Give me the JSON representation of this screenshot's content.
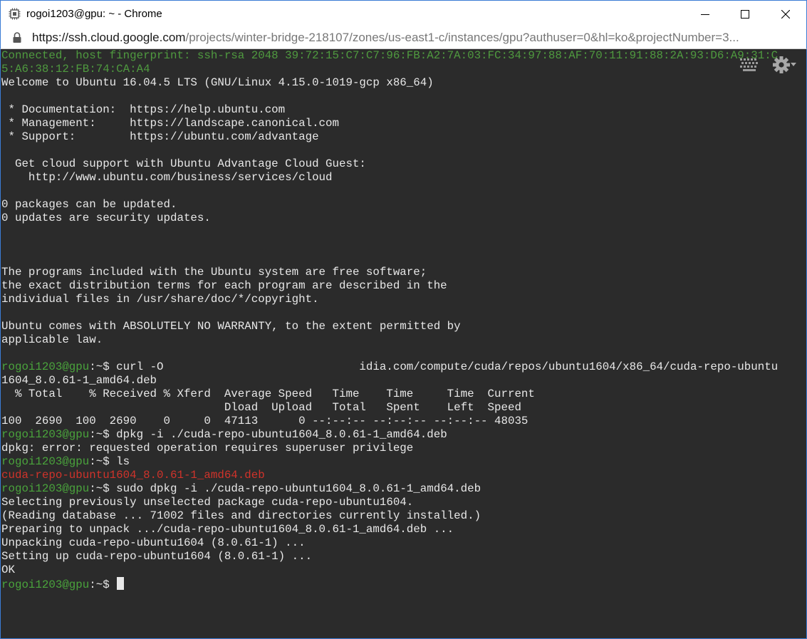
{
  "window": {
    "title": "rogoi1203@gpu: ~ - Chrome"
  },
  "address": {
    "host": "https://ssh.cloud.google.com",
    "path": "/projects/winter-bridge-218107/zones/us-east1-c/instances/gpu?authuser=0&hl=ko&projectNumber=3..."
  },
  "terminal": {
    "prompt_user": "rogoi1203@gpu",
    "prompt_suffix": ":~$",
    "lines": [
      {
        "segments": [
          {
            "text": "Connected, host fingerprint: ssh-rsa 2048 39:72:15:C7:C7:96:FB:A2:7A:03:FC:34:97:88:AF:70:11:91:88:2A:93:D6:A9:31:C",
            "style": "green-dim"
          }
        ]
      },
      {
        "segments": [
          {
            "text": "5:A6:38:12:FB:74:CA:A4",
            "style": "green-dim"
          }
        ]
      },
      {
        "segments": [
          {
            "text": "Welcome to Ubuntu 16.04.5 LTS (GNU/Linux 4.15.0-1019-gcp x86_64)",
            "style": ""
          }
        ]
      },
      {
        "segments": [
          {
            "text": "",
            "style": ""
          }
        ]
      },
      {
        "segments": [
          {
            "text": " * Documentation:  https://help.ubuntu.com",
            "style": ""
          }
        ]
      },
      {
        "segments": [
          {
            "text": " * Management:     https://landscape.canonical.com",
            "style": ""
          }
        ]
      },
      {
        "segments": [
          {
            "text": " * Support:        https://ubuntu.com/advantage",
            "style": ""
          }
        ]
      },
      {
        "segments": [
          {
            "text": "",
            "style": ""
          }
        ]
      },
      {
        "segments": [
          {
            "text": "  Get cloud support with Ubuntu Advantage Cloud Guest:",
            "style": ""
          }
        ]
      },
      {
        "segments": [
          {
            "text": "    http://www.ubuntu.com/business/services/cloud",
            "style": ""
          }
        ]
      },
      {
        "segments": [
          {
            "text": "",
            "style": ""
          }
        ]
      },
      {
        "segments": [
          {
            "text": "0 packages can be updated.",
            "style": ""
          }
        ]
      },
      {
        "segments": [
          {
            "text": "0 updates are security updates.",
            "style": ""
          }
        ]
      },
      {
        "segments": [
          {
            "text": "",
            "style": ""
          }
        ]
      },
      {
        "segments": [
          {
            "text": "",
            "style": ""
          }
        ]
      },
      {
        "segments": [
          {
            "text": "",
            "style": ""
          }
        ]
      },
      {
        "segments": [
          {
            "text": "The programs included with the Ubuntu system are free software;",
            "style": ""
          }
        ]
      },
      {
        "segments": [
          {
            "text": "the exact distribution terms for each program are described in the",
            "style": ""
          }
        ]
      },
      {
        "segments": [
          {
            "text": "individual files in /usr/share/doc/*/copyright.",
            "style": ""
          }
        ]
      },
      {
        "segments": [
          {
            "text": "",
            "style": ""
          }
        ]
      },
      {
        "segments": [
          {
            "text": "Ubuntu comes with ABSOLUTELY NO WARRANTY, to the extent permitted by",
            "style": ""
          }
        ]
      },
      {
        "segments": [
          {
            "text": "applicable law.",
            "style": ""
          }
        ]
      },
      {
        "segments": [
          {
            "text": "",
            "style": ""
          }
        ]
      },
      {
        "segments": [
          {
            "text": "rogoi1203@gpu",
            "style": "green"
          },
          {
            "text": ":~$ curl -O                             idia.com/compute/cuda/repos/ubuntu1604/x86_64/cuda-repo-ubuntu",
            "style": ""
          }
        ]
      },
      {
        "segments": [
          {
            "text": "1604_8.0.61-1_amd64.deb",
            "style": ""
          }
        ]
      },
      {
        "segments": [
          {
            "text": "  % Total    % Received % Xferd  Average Speed   Time    Time     Time  Current",
            "style": ""
          }
        ]
      },
      {
        "segments": [
          {
            "text": "                                 Dload  Upload   Total   Spent    Left  Speed",
            "style": ""
          }
        ]
      },
      {
        "segments": [
          {
            "text": "100  2690  100  2690    0     0  47113      0 --:--:-- --:--:-- --:--:-- 48035",
            "style": ""
          }
        ]
      },
      {
        "segments": [
          {
            "text": "rogoi1203@gpu",
            "style": "green"
          },
          {
            "text": ":~$ dpkg -i ./cuda-repo-ubuntu1604_8.0.61-1_amd64.deb",
            "style": ""
          }
        ]
      },
      {
        "segments": [
          {
            "text": "dpkg: error: requested operation requires superuser privilege",
            "style": ""
          }
        ]
      },
      {
        "segments": [
          {
            "text": "rogoi1203@gpu",
            "style": "green"
          },
          {
            "text": ":~$ ls",
            "style": ""
          }
        ]
      },
      {
        "segments": [
          {
            "text": "cuda-repo-ubuntu1604_8.0.61-1_amd64.deb",
            "style": "red"
          }
        ]
      },
      {
        "segments": [
          {
            "text": "rogoi1203@gpu",
            "style": "green"
          },
          {
            "text": ":~$ sudo dpkg -i ./cuda-repo-ubuntu1604_8.0.61-1_amd64.deb",
            "style": ""
          }
        ]
      },
      {
        "segments": [
          {
            "text": "Selecting previously unselected package cuda-repo-ubuntu1604.",
            "style": ""
          }
        ]
      },
      {
        "segments": [
          {
            "text": "(Reading database ... 71002 files and directories currently installed.)",
            "style": ""
          }
        ]
      },
      {
        "segments": [
          {
            "text": "Preparing to unpack .../cuda-repo-ubuntu1604_8.0.61-1_amd64.deb ...",
            "style": ""
          }
        ]
      },
      {
        "segments": [
          {
            "text": "Unpacking cuda-repo-ubuntu1604 (8.0.61-1) ...",
            "style": ""
          }
        ]
      },
      {
        "segments": [
          {
            "text": "Setting up cuda-repo-ubuntu1604 (8.0.61-1) ...",
            "style": ""
          }
        ]
      },
      {
        "segments": [
          {
            "text": "OK",
            "style": ""
          }
        ]
      },
      {
        "segments": [
          {
            "text": "rogoi1203@gpu",
            "style": "green"
          },
          {
            "text": ":~$ ",
            "style": ""
          }
        ],
        "cursor": true
      }
    ]
  },
  "icons": {
    "keyboard": "keyboard-icon",
    "settings": "gear-icon",
    "lock": "lock-icon",
    "app": "chip-icon"
  },
  "colors": {
    "terminal_bg": "#2b2b2b",
    "prompt_green": "#4aa43c",
    "error_red": "#d0332b",
    "frame_border": "#3a7bd5"
  }
}
